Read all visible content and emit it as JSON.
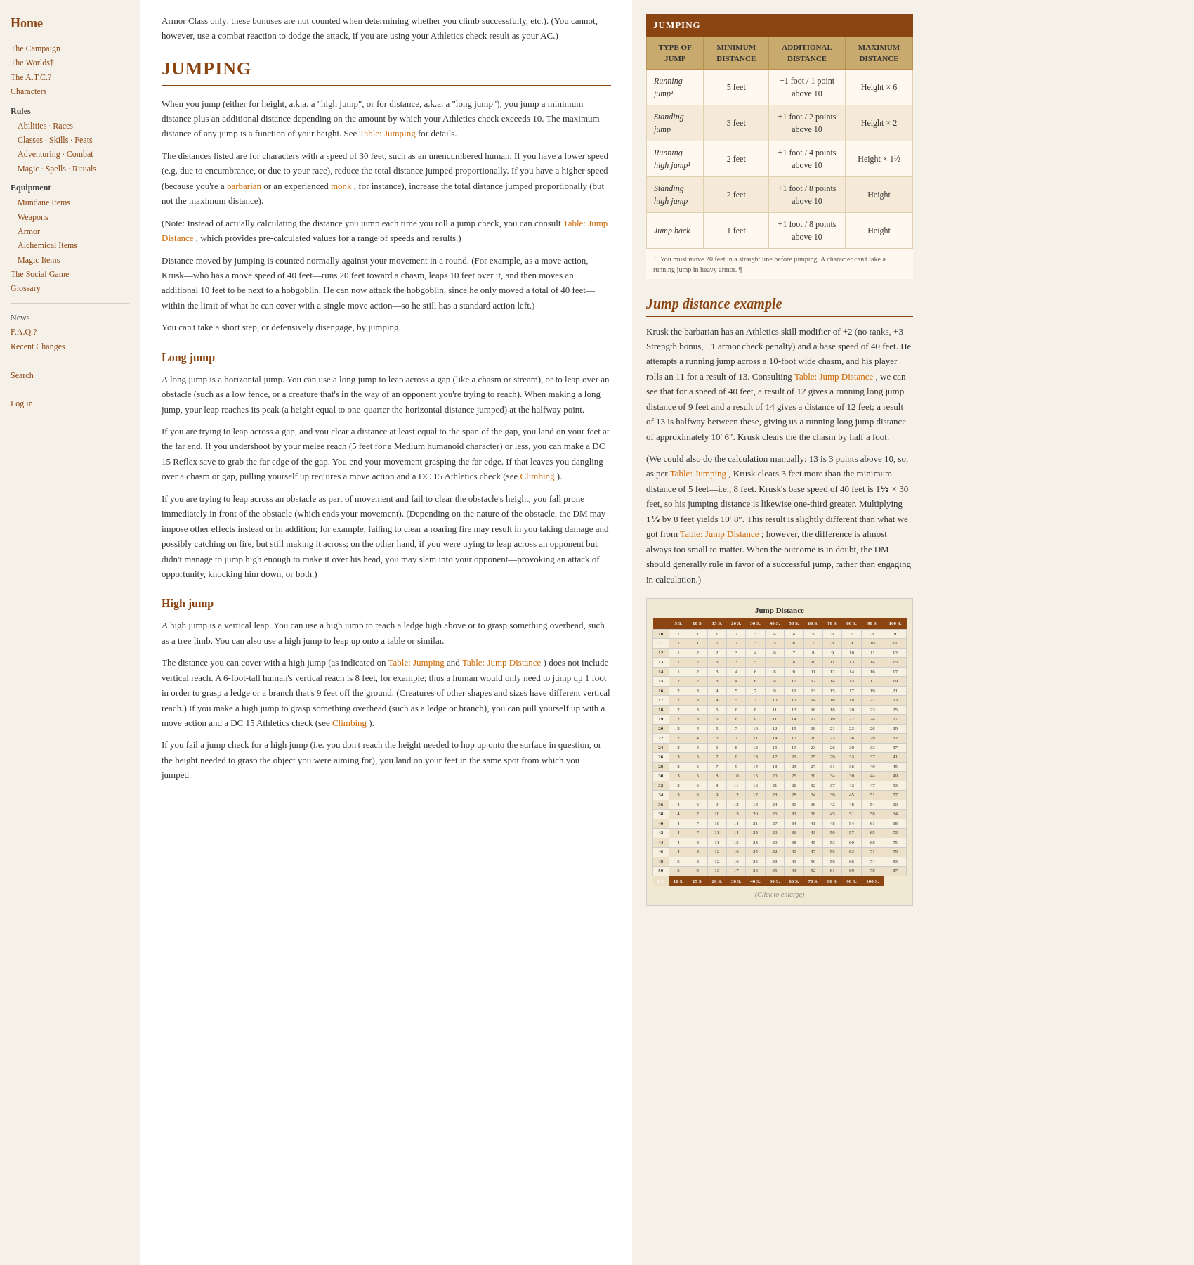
{
  "sidebar": {
    "home_label": "Home",
    "links": [
      {
        "label": "The Campaign",
        "href": "#",
        "type": "link"
      },
      {
        "label": "The Worlds†",
        "href": "#",
        "type": "link"
      },
      {
        "label": "The A.T.C.?",
        "href": "#",
        "type": "link"
      },
      {
        "label": "Characters",
        "href": "#",
        "type": "link"
      },
      {
        "label": "Rules",
        "type": "category"
      },
      {
        "label": "Abilities · Races",
        "href": "#",
        "type": "link",
        "indent": true
      },
      {
        "label": "Classes · Skills · Feats",
        "href": "#",
        "type": "link",
        "indent": true
      },
      {
        "label": "Adventuring · Combat",
        "href": "#",
        "type": "link",
        "indent": true
      },
      {
        "label": "Magic · Spells · Rituals",
        "href": "#",
        "type": "link",
        "indent": true
      },
      {
        "label": "Equipment",
        "type": "category"
      },
      {
        "label": "Mundane Items",
        "href": "#",
        "type": "link",
        "indent": true
      },
      {
        "label": "Weapons",
        "href": "#",
        "type": "link",
        "indent": true
      },
      {
        "label": "Armor",
        "href": "#",
        "type": "link",
        "indent": true
      },
      {
        "label": "Alchemical Items",
        "href": "#",
        "type": "link",
        "indent": true
      },
      {
        "label": "Magic Items",
        "href": "#",
        "type": "link",
        "indent": true
      },
      {
        "label": "The Social Game",
        "href": "#",
        "type": "link"
      },
      {
        "label": "Glossary",
        "href": "#",
        "type": "link"
      }
    ],
    "bottom_links": [
      {
        "label": "News"
      },
      {
        "label": "F.A.Q.?",
        "href": "#",
        "type": "link"
      },
      {
        "label": "Recent Changes",
        "href": "#",
        "type": "link"
      }
    ],
    "search_label": "Search",
    "login_label": "Log in"
  },
  "main": {
    "intro_text": "Armor Class only; these bonuses are not counted when determining whether you climb successfully, etc.). (You cannot, however, use a combat reaction to dodge the attack, if you are using your Athletics check result as your AC.)",
    "section_title": "JUMPING",
    "jumping_intro": "When you jump (either for height, a.k.a. a \"high jump\", or for distance, a.k.a. a \"long jump\"), you jump a minimum distance plus an additional distance depending on the amount by which your Athletics check exceeds 10. The maximum distance of any jump is a function of your height. See",
    "jumping_intro_link": "Table: Jumping",
    "jumping_intro_end": "for details.",
    "distances_note": "The distances listed are for characters with a speed of 30 feet, such as an unencumbered human. If you have a lower speed (e.g. due to encumbrance, or due to your race), reduce the total distance jumped proportionally. If you have a higher speed (because you're a",
    "barbarian_link": "barbarian",
    "or_text": "or an experienced",
    "monk_link": "monk",
    "speed_note_end": ", for instance), increase the total distance jumped proportionally (but not the maximum distance).",
    "note_para": "(Note: Instead of actually calculating the distance you jump each time you roll a jump check, you can consult",
    "table_jump_distance_link": "Table: Jump Distance",
    "note_para_end": ", which provides pre-calculated values for a range of speeds and results.)",
    "distance_moved_para": "Distance moved by jumping is counted normally against your movement in a round. (For example, as a move action, Krusk—who has a move speed of 40 feet—runs 20 feet toward a chasm, leaps 10 feet over it, and then moves an additional 10 feet to be next to a hobgoblin. He can now attack the hobgoblin, since he only moved a total of 40 feet—within the limit of what he can cover with a single move action—so he still has a standard action left.)",
    "cant_short_step": "You can't take a short step, or defensively disengage, by jumping.",
    "long_jump_title": "Long jump",
    "long_jump_para1": "A long jump is a horizontal jump. You can use a long jump to leap across a gap (like a chasm or stream), or to leap over an obstacle (such as a low fence, or a creature that's in the way of an opponent you're trying to reach). When making a long jump, your leap reaches its peak (a height equal to one-quarter the horizontal distance jumped) at the halfway point.",
    "long_jump_para2": "If you are trying to leap across a gap, and you clear a distance at least equal to the span of the gap, you land on your feet at the far end. If you undershoot by your melee reach (5 feet for a Medium humanoid character) or less, you can make a DC 15 Reflex save to grab the far edge of the gap. You end your movement grasping the far edge. If that leaves you dangling over a chasm or gap, pulling yourself up requires a move action and a DC 15 Athletics check (see",
    "climbing_link1": "Climbing",
    "long_jump_para2_end": ").",
    "long_jump_para3": "If you are trying to leap across an obstacle as part of movement and fail to clear the obstacle's height, you fall prone immediately in front of the obstacle (which ends your movement). (Depending on the nature of the obstacle, the DM may impose other effects instead or in addition; for example, failing to clear a roaring fire may result in you taking damage and possibly catching on fire, but still making it across; on the other hand, if you were trying to leap across an opponent but didn't manage to jump high enough to make it over his head, you may slam into your opponent—provoking an attack of opportunity, knocking him down, or both.)",
    "high_jump_title": "High jump",
    "high_jump_para1": "A high jump is a vertical leap. You can use a high jump to reach a ledge high above or to grasp something overhead, such as a tree limb. You can also use a high jump to leap up onto a table or similar.",
    "high_jump_para2": "The distance you can cover with a high jump (as indicated on",
    "table_jumping_link": "Table: Jumping",
    "high_jump_para2_mid": "and",
    "table_jump_distance_link2": "Table: Jump Distance",
    "high_jump_para2_end": ") does not include vertical reach. A 6-foot-tall human's vertical reach is 8 feet, for example; thus a human would only need to jump up 1 foot in order to grasp a ledge or a branch that's 9 feet off the ground. (Creatures of other shapes and sizes have different vertical reach.) If you make a high jump to grasp something overhead (such as a ledge or branch), you can pull yourself up with a move action and a DC 15 Athletics check (see",
    "climbing_link2": "Climbing",
    "high_jump_para2_end2": ").",
    "high_jump_para3": "If you fail a jump check for a high jump (i.e. you don't reach the height needed to hop up onto the surface in question, or the height needed to grasp the object you were aiming for), you land on your feet in the same spot from which you jumped."
  },
  "jump_table": {
    "title": "JUMPING",
    "headers": [
      "TYPE OF JUMP",
      "MINIMUM DISTANCE",
      "ADDITIONAL DISTANCE",
      "MAXIMUM DISTANCE"
    ],
    "rows": [
      {
        "type": "Running jump¹",
        "min": "5 feet",
        "additional": "+1 foot / 1 point above 10",
        "max": "Height × 6"
      },
      {
        "type": "Standing jump",
        "min": "3 feet",
        "additional": "+1 foot / 2 points above 10",
        "max": "Height × 2"
      },
      {
        "type": "Running high jump¹",
        "min": "2 feet",
        "additional": "+1 foot / 4 points above 10",
        "max": "Height × 1½"
      },
      {
        "type": "Standing high jump",
        "min": "2 feet",
        "additional": "+1 foot / 8 points above 10",
        "max": "Height"
      },
      {
        "type": "Jump back",
        "min": "1 feet",
        "additional": "+1 foot / 8 points above 10",
        "max": "Height"
      }
    ],
    "footnote": "1. You must move 20 feet in a straight line before jumping. A character can't take a running jump in heavy armor. ¶"
  },
  "jump_example": {
    "title": "Jump distance example",
    "para1": "Krusk the barbarian has an Athletics skill modifier of +2 (no ranks, +3 Strength bonus, −1 armor check penalty) and a base speed of 40 feet. He attempts a running jump across a 10-foot wide chasm, and his player rolls an 11 for a result of 13. Consulting",
    "table_link": "Table: Jump Distance",
    "para1_mid": ", we can see that for a speed of 40 feet, a result of 12 gives a running long jump distance of 9 feet and a result of 14 gives a distance of 12 feet; a result of 13 is halfway between these, giving us a running long jump distance of approximately 10′ 6″. Krusk clears the the chasm by half a foot.",
    "para2": "(We could also do the calculation manually: 13 is 3 points above 10, so, as per",
    "table_link2": "Table: Jumping",
    "para2_mid": ", Krusk clears 3 feet more than the minimum distance of 5 feet—i.e., 8 feet. Krusk's base speed of 40 feet is 1⅓ × 30 feet, so his jumping distance is likewise one-third greater. Multiplying 1⅓ by 8 feet yields 10′ 8″. This result is slightly different than what we got from",
    "table_link3": "Table: Jump Distance",
    "para2_end": "; however, the difference is almost always too small to matter. When the outcome is in doubt, the DM should generally rule in favor of a successful jump, rather than engaging in calculation.)"
  },
  "jump_distance_small": {
    "title": "Jump Distance",
    "click_enlarge": "(Click to enlarge)",
    "col_headers": [
      "5 S.",
      "10 S.",
      "15 S.",
      "20 S.",
      "30 S.",
      "40 S.",
      "50 S.",
      "60 S.",
      "70 S.",
      "80 S.",
      "90 S.",
      "100 S."
    ],
    "rows": [
      [
        "10",
        "1",
        "1",
        "1",
        "2",
        "3",
        "4",
        "4",
        "5",
        "6",
        "7",
        "8",
        "9"
      ],
      [
        "11",
        "1",
        "1",
        "2",
        "2",
        "3",
        "5",
        "6",
        "7",
        "8",
        "9",
        "10",
        "11"
      ],
      [
        "12",
        "1",
        "2",
        "2",
        "3",
        "4",
        "6",
        "7",
        "8",
        "9",
        "10",
        "11",
        "12"
      ],
      [
        "13",
        "1",
        "2",
        "3",
        "3",
        "5",
        "7",
        "8",
        "10",
        "11",
        "13",
        "14",
        "15"
      ],
      [
        "14",
        "1",
        "2",
        "3",
        "4",
        "6",
        "8",
        "9",
        "11",
        "12",
        "14",
        "16",
        "17"
      ],
      [
        "15",
        "2",
        "2",
        "3",
        "4",
        "6",
        "8",
        "10",
        "12",
        "14",
        "15",
        "17",
        "19"
      ],
      [
        "16",
        "2",
        "3",
        "4",
        "5",
        "7",
        "9",
        "11",
        "13",
        "15",
        "17",
        "19",
        "21"
      ],
      [
        "17",
        "2",
        "3",
        "4",
        "5",
        "7",
        "10",
        "12",
        "14",
        "16",
        "18",
        "21",
        "23"
      ],
      [
        "18",
        "2",
        "3",
        "5",
        "6",
        "8",
        "11",
        "13",
        "16",
        "18",
        "20",
        "23",
        "25"
      ],
      [
        "19",
        "2",
        "3",
        "5",
        "6",
        "9",
        "11",
        "14",
        "17",
        "19",
        "22",
        "24",
        "27"
      ],
      [
        "20",
        "2",
        "4",
        "5",
        "7",
        "10",
        "12",
        "15",
        "18",
        "21",
        "23",
        "26",
        "29"
      ],
      [
        "22",
        "2",
        "4",
        "6",
        "7",
        "11",
        "14",
        "17",
        "20",
        "23",
        "26",
        "29",
        "32"
      ],
      [
        "24",
        "3",
        "4",
        "6",
        "8",
        "12",
        "15",
        "19",
        "23",
        "26",
        "30",
        "33",
        "37"
      ],
      [
        "26",
        "3",
        "5",
        "7",
        "9",
        "13",
        "17",
        "21",
        "25",
        "29",
        "33",
        "37",
        "41"
      ],
      [
        "28",
        "3",
        "5",
        "7",
        "9",
        "14",
        "18",
        "23",
        "27",
        "31",
        "36",
        "40",
        "45"
      ],
      [
        "30",
        "3",
        "5",
        "8",
        "10",
        "15",
        "20",
        "25",
        "30",
        "34",
        "39",
        "44",
        "49"
      ],
      [
        "32",
        "3",
        "6",
        "8",
        "11",
        "16",
        "21",
        "26",
        "32",
        "37",
        "42",
        "47",
        "53"
      ],
      [
        "34",
        "3",
        "6",
        "9",
        "12",
        "17",
        "23",
        "28",
        "34",
        "39",
        "45",
        "51",
        "57"
      ],
      [
        "36",
        "4",
        "6",
        "9",
        "12",
        "18",
        "24",
        "30",
        "36",
        "42",
        "48",
        "54",
        "60"
      ],
      [
        "38",
        "4",
        "7",
        "10",
        "13",
        "20",
        "26",
        "32",
        "38",
        "45",
        "51",
        "58",
        "64"
      ],
      [
        "40",
        "4",
        "7",
        "10",
        "14",
        "21",
        "27",
        "34",
        "41",
        "48",
        "54",
        "61",
        "68"
      ],
      [
        "42",
        "4",
        "7",
        "11",
        "14",
        "22",
        "29",
        "36",
        "43",
        "50",
        "57",
        "65",
        "72"
      ],
      [
        "44",
        "4",
        "8",
        "11",
        "15",
        "23",
        "30",
        "38",
        "45",
        "53",
        "60",
        "68",
        "75"
      ],
      [
        "46",
        "4",
        "8",
        "12",
        "16",
        "24",
        "32",
        "40",
        "47",
        "55",
        "63",
        "71",
        "79"
      ],
      [
        "48",
        "5",
        "8",
        "12",
        "16",
        "25",
        "33",
        "41",
        "50",
        "58",
        "66",
        "74",
        "83"
      ],
      [
        "50",
        "5",
        "9",
        "13",
        "17",
        "26",
        "35",
        "43",
        "52",
        "61",
        "69",
        "78",
        "87"
      ],
      [
        "5 S.",
        "10 S.",
        "15 S.",
        "20 S.",
        "30 S.",
        "40 S.",
        "50 S.",
        "60 S.",
        "70 S.",
        "80 S.",
        "90 S.",
        "100 S."
      ]
    ]
  }
}
